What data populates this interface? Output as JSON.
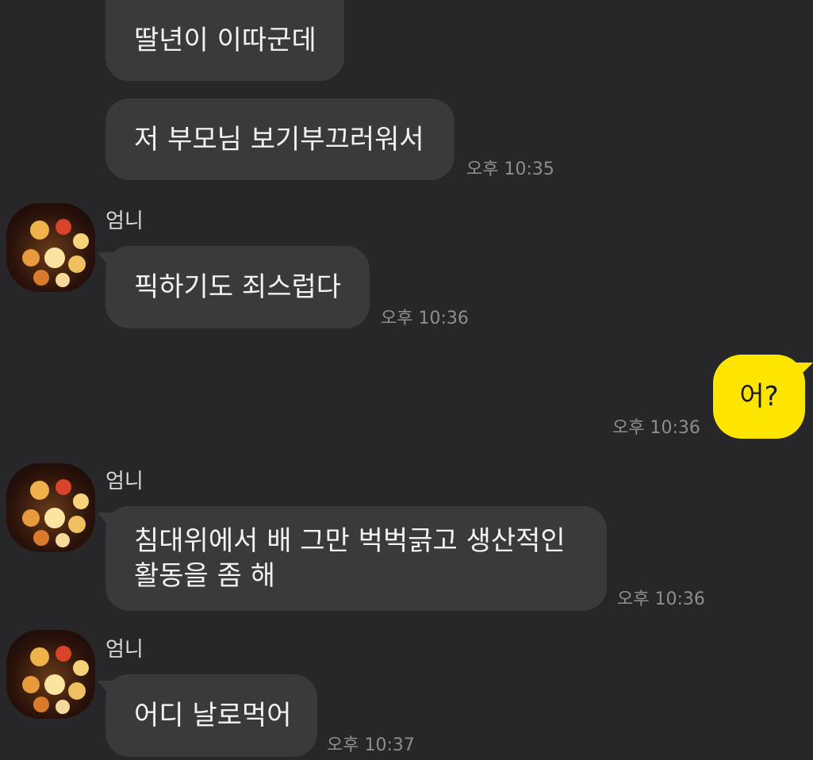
{
  "messages": [
    {
      "id": "m1",
      "from": "other",
      "text": "딸년이 이따군데"
    },
    {
      "id": "m2",
      "from": "other",
      "text": "저 부모님 보기부끄러워서",
      "time": "오후 10:35"
    },
    {
      "id": "m3",
      "from": "other",
      "sender": "엄니",
      "text": "픽하기도 죄스럽다",
      "time": "오후 10:36"
    },
    {
      "id": "m4",
      "from": "me",
      "text": "어?",
      "time": "오후 10:36"
    },
    {
      "id": "m5",
      "from": "other",
      "sender": "엄니",
      "lines": [
        "침대위에서 배 그만 벅벅긁고 생산적인",
        "활동을 좀 해"
      ],
      "time": "오후 10:36"
    },
    {
      "id": "m6",
      "from": "other",
      "sender": "엄니",
      "text": "어디 날로먹어",
      "time": "오후 10:37"
    }
  ],
  "colors": {
    "background": "#272729",
    "bubble_other": "#3a3a3c",
    "bubble_mine": "#fee500",
    "time_text": "#8e8e90"
  },
  "icons": {
    "avatar": "lantern-photo-avatar"
  }
}
